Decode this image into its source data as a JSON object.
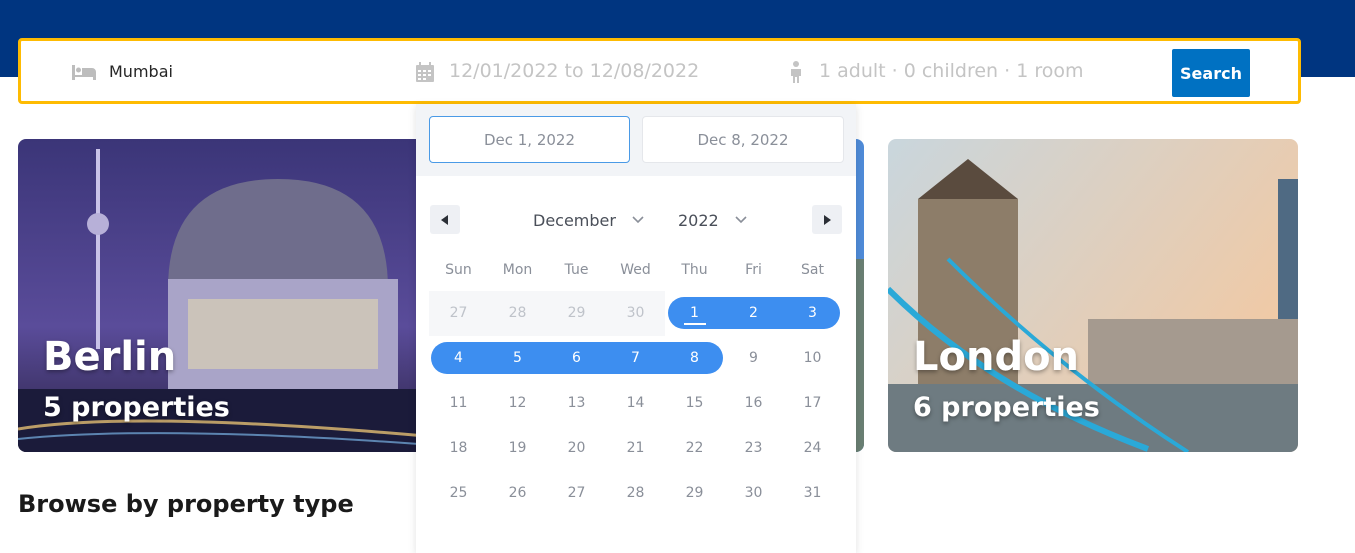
{
  "search": {
    "destination": "Mumbai",
    "dates": "12/01/2022 to 12/08/2022",
    "guests": "1 adult · 0 children · 1 room",
    "search_label": "Search",
    "icons": [
      "bed-icon",
      "calendar-icon",
      "person-icon"
    ]
  },
  "cards": [
    {
      "title": "Berlin",
      "subtitle": "5 properties"
    },
    {
      "title": "London",
      "subtitle": "6 properties"
    }
  ],
  "section_title": "Browse by property type",
  "datepicker": {
    "start_value": "Dec 1, 2022",
    "end_value": "Dec 8, 2022",
    "month": "December",
    "year": "2022",
    "weekdays": [
      "Sun",
      "Mon",
      "Tue",
      "Wed",
      "Thu",
      "Fri",
      "Sat"
    ],
    "weeks": [
      [
        "27",
        "28",
        "29",
        "30",
        "1",
        "2",
        "3"
      ],
      [
        "4",
        "5",
        "6",
        "7",
        "8",
        "9",
        "10"
      ],
      [
        "11",
        "12",
        "13",
        "14",
        "15",
        "16",
        "17"
      ],
      [
        "18",
        "19",
        "20",
        "21",
        "22",
        "23",
        "24"
      ],
      [
        "25",
        "26",
        "27",
        "28",
        "29",
        "30",
        "31"
      ]
    ],
    "selected_start": "1",
    "selected_end": "8",
    "colors": {
      "accent": "#3d8ef0",
      "header": "#003580",
      "search_button": "#0071c2",
      "border": "#febb02"
    }
  }
}
